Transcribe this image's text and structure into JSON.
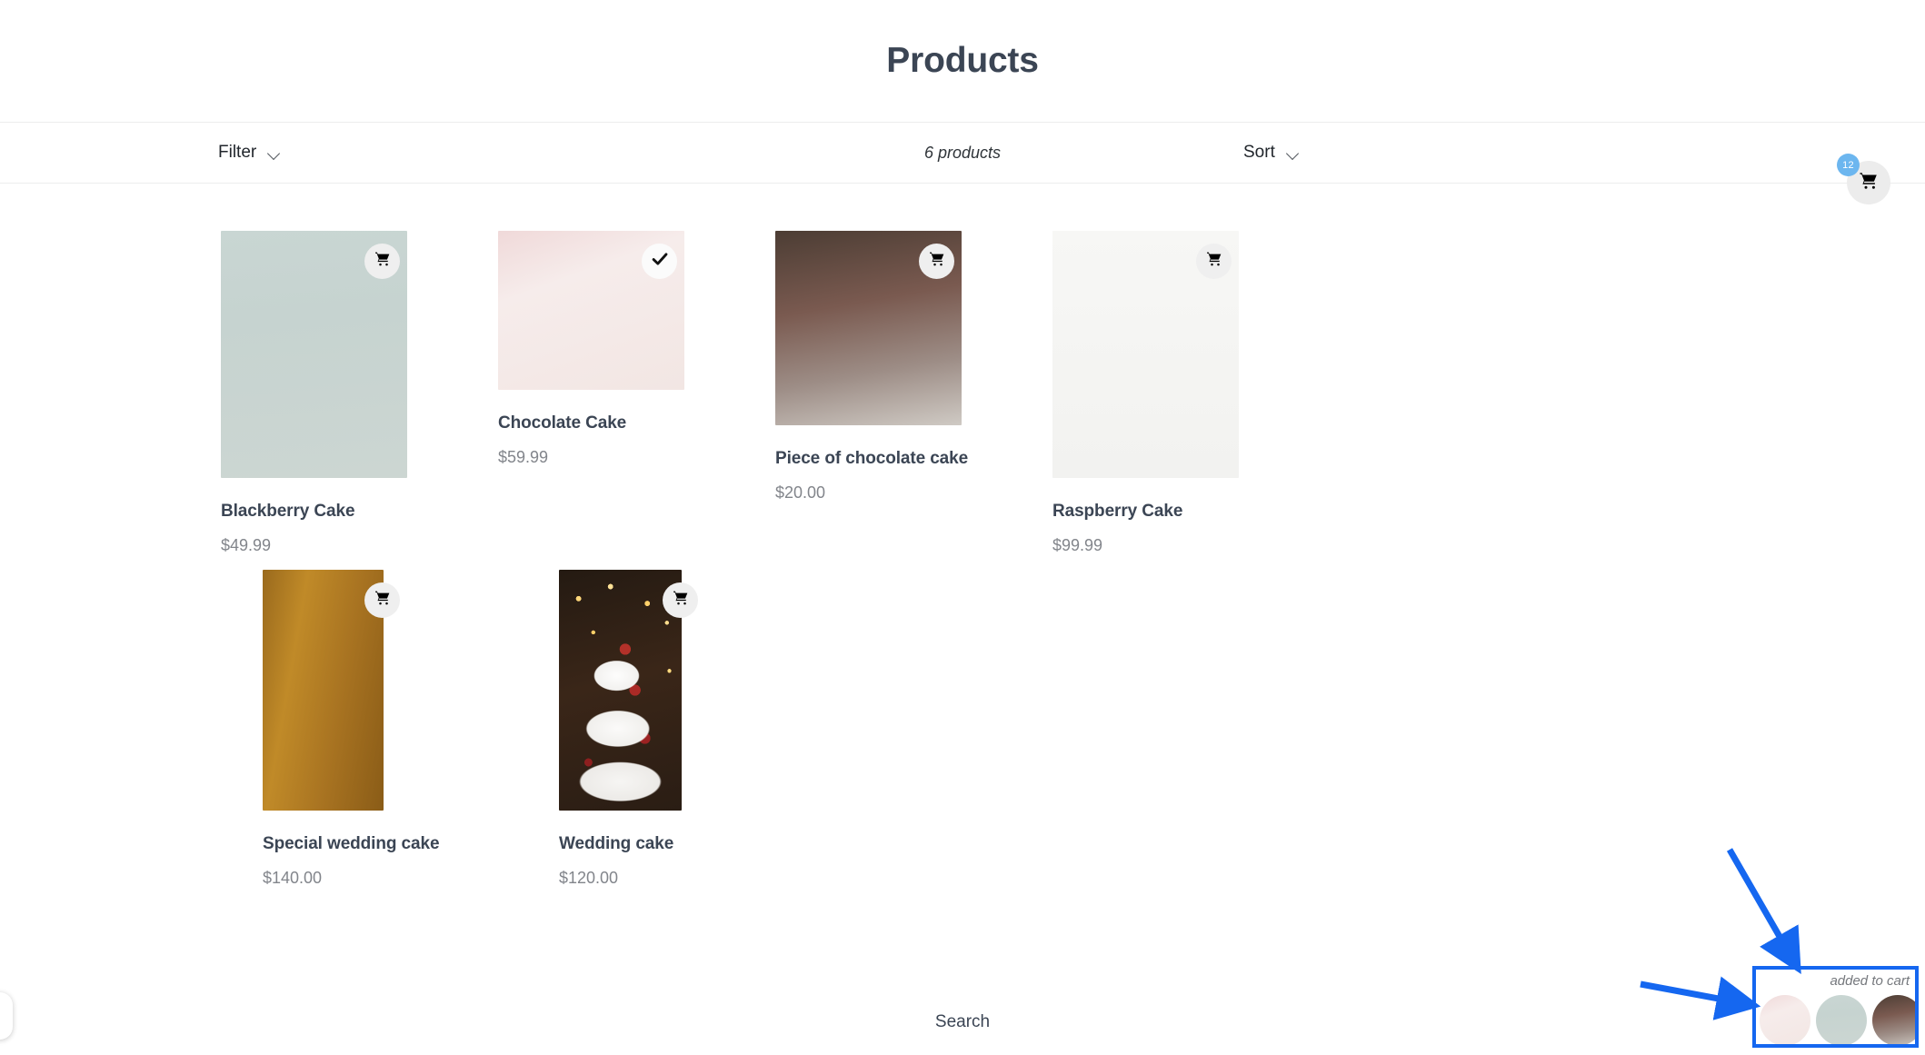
{
  "header": {
    "title": "Products"
  },
  "toolbar": {
    "filter_label": "Filter",
    "count_label": "6 products",
    "sort_label": "Sort"
  },
  "cart": {
    "badge_count": "12",
    "icon": "shopping-cart-icon"
  },
  "products": [
    {
      "title": "Blackberry Cake",
      "price": "$49.99",
      "action_icon": "shopping-cart-icon",
      "state": "add"
    },
    {
      "title": "Chocolate Cake",
      "price": "$59.99",
      "action_icon": "check-icon",
      "state": "added"
    },
    {
      "title": "Piece of chocolate cake",
      "price": "$20.00",
      "action_icon": "shopping-cart-icon",
      "state": "add"
    },
    {
      "title": "Raspberry Cake",
      "price": "$99.99",
      "action_icon": "shopping-cart-icon",
      "state": "add"
    },
    {
      "title": "Special wedding cake",
      "price": "$140.00",
      "action_icon": "shopping-cart-icon",
      "state": "add"
    },
    {
      "title": "Wedding cake",
      "price": "$120.00",
      "action_icon": "shopping-cart-icon",
      "state": "add"
    }
  ],
  "footer": {
    "search_label": "Search"
  },
  "toast": {
    "label": "added to cart",
    "thumbnail_count": 3
  },
  "colors": {
    "accent_badge": "#6cb6ef",
    "annotation": "#1567f0",
    "title_text": "#3b4554",
    "price_text": "#82858b",
    "divider": "#eceded"
  }
}
